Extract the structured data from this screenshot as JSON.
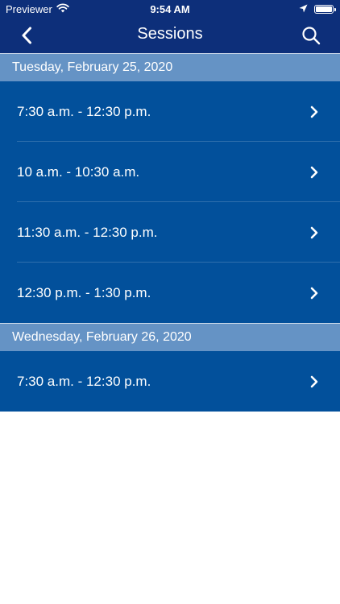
{
  "status_bar": {
    "carrier": "Previewer",
    "time": "9:54 AM"
  },
  "nav": {
    "title": "Sessions"
  },
  "sections": [
    {
      "header": "Tuesday, February 25, 2020",
      "sessions": [
        {
          "label": "7:30 a.m. - 12:30 p.m."
        },
        {
          "label": "10 a.m. - 10:30 a.m."
        },
        {
          "label": "11:30 a.m. - 12:30 p.m."
        },
        {
          "label": "12:30 p.m. - 1:30 p.m."
        }
      ]
    },
    {
      "header": "Wednesday, February 26, 2020",
      "sessions": [
        {
          "label": "7:30 a.m. - 12:30 p.m."
        }
      ]
    }
  ],
  "colors": {
    "nav_background": "#0d2f7a",
    "row_background": "#02509b",
    "section_header_background": "#6593c5"
  },
  "icons": {
    "back": "chevron-left-icon",
    "search": "search-icon",
    "row": "chevron-right-icon",
    "wifi": "wifi-icon",
    "location": "location-arrow-icon",
    "battery": "battery-icon"
  }
}
